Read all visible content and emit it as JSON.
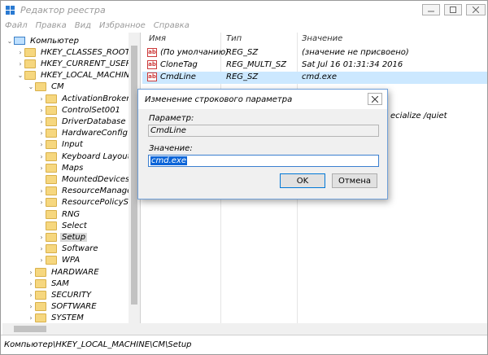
{
  "window": {
    "title": "Редактор реестра"
  },
  "menu": [
    "Файл",
    "Правка",
    "Вид",
    "Избранное",
    "Справка"
  ],
  "tree": [
    {
      "label": "Компьютер",
      "level": 0,
      "expanded": true,
      "icon": "computer-icon"
    },
    {
      "label": "HKEY_CLASSES_ROOT",
      "level": 1,
      "expanded": false
    },
    {
      "label": "HKEY_CURRENT_USER",
      "level": 1,
      "expanded": false
    },
    {
      "label": "HKEY_LOCAL_MACHINE",
      "level": 1,
      "expanded": true
    },
    {
      "label": "CM",
      "level": 2,
      "expanded": true
    },
    {
      "label": "ActivationBroker",
      "level": 3,
      "expanded": false
    },
    {
      "label": "ControlSet001",
      "level": 3,
      "expanded": false
    },
    {
      "label": "DriverDatabase",
      "level": 3,
      "expanded": false
    },
    {
      "label": "HardwareConfig",
      "level": 3,
      "expanded": false
    },
    {
      "label": "Input",
      "level": 3,
      "expanded": false
    },
    {
      "label": "Keyboard Layout",
      "level": 3,
      "expanded": false
    },
    {
      "label": "Maps",
      "level": 3,
      "expanded": false
    },
    {
      "label": "MountedDevices",
      "level": 3,
      "expanded": null
    },
    {
      "label": "ResourceManager",
      "level": 3,
      "expanded": false
    },
    {
      "label": "ResourcePolicyStor",
      "level": 3,
      "expanded": false
    },
    {
      "label": "RNG",
      "level": 3,
      "expanded": null
    },
    {
      "label": "Select",
      "level": 3,
      "expanded": null
    },
    {
      "label": "Setup",
      "level": 3,
      "expanded": false,
      "selected": true
    },
    {
      "label": "Software",
      "level": 3,
      "expanded": false
    },
    {
      "label": "WPA",
      "level": 3,
      "expanded": false
    },
    {
      "label": "HARDWARE",
      "level": 2,
      "expanded": false
    },
    {
      "label": "SAM",
      "level": 2,
      "expanded": false
    },
    {
      "label": "SECURITY",
      "level": 2,
      "expanded": false
    },
    {
      "label": "SOFTWARE",
      "level": 2,
      "expanded": false
    },
    {
      "label": "SYSTEM",
      "level": 2,
      "expanded": false
    }
  ],
  "list": {
    "headers": {
      "name": "Имя",
      "type": "Тип",
      "value": "Значение"
    },
    "rows": [
      {
        "name": "(По умолчанию)",
        "type": "REG_SZ",
        "value": "(значение не присвоено)"
      },
      {
        "name": "CloneTag",
        "type": "REG_MULTI_SZ",
        "value": "Sat Jul 16 01:31:34 2016"
      },
      {
        "name": "CmdLine",
        "type": "REG_SZ",
        "value": "cmd.exe",
        "selected": true
      }
    ],
    "partial_value": "ecialize /quiet"
  },
  "status": {
    "path": "Компьютер\\HKEY_LOCAL_MACHINE\\CM\\Setup"
  },
  "dialog": {
    "title": "Изменение строкового параметра",
    "param_label": "Параметр:",
    "param_value": "CmdLine",
    "value_label": "Значение:",
    "value_text": "cmd.exe",
    "ok": "OK",
    "cancel": "Отмена"
  }
}
